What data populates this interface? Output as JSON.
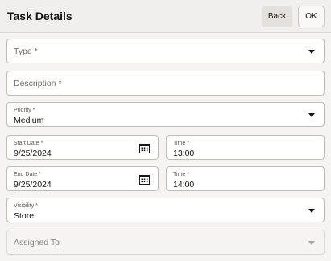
{
  "header": {
    "title": "Task Details",
    "back_label": "Back",
    "ok_label": "OK"
  },
  "form": {
    "type": {
      "placeholder": "Type *"
    },
    "description": {
      "placeholder": "Description *"
    },
    "priority": {
      "label": "Priority *",
      "value": "Medium"
    },
    "start_date": {
      "label": "Start Date *",
      "value": "9/25/2024"
    },
    "start_time": {
      "label": "Time *",
      "value": "13:00"
    },
    "end_date": {
      "label": "End Date *",
      "value": "9/25/2024"
    },
    "end_time": {
      "label": "Time *",
      "value": "14:00"
    },
    "visibility": {
      "label": "Visibility *",
      "value": "Store"
    },
    "assigned_to": {
      "placeholder": "Assigned To"
    }
  },
  "icons": {
    "dropdown": "chevron-down-icon",
    "calendar": "calendar-icon"
  }
}
